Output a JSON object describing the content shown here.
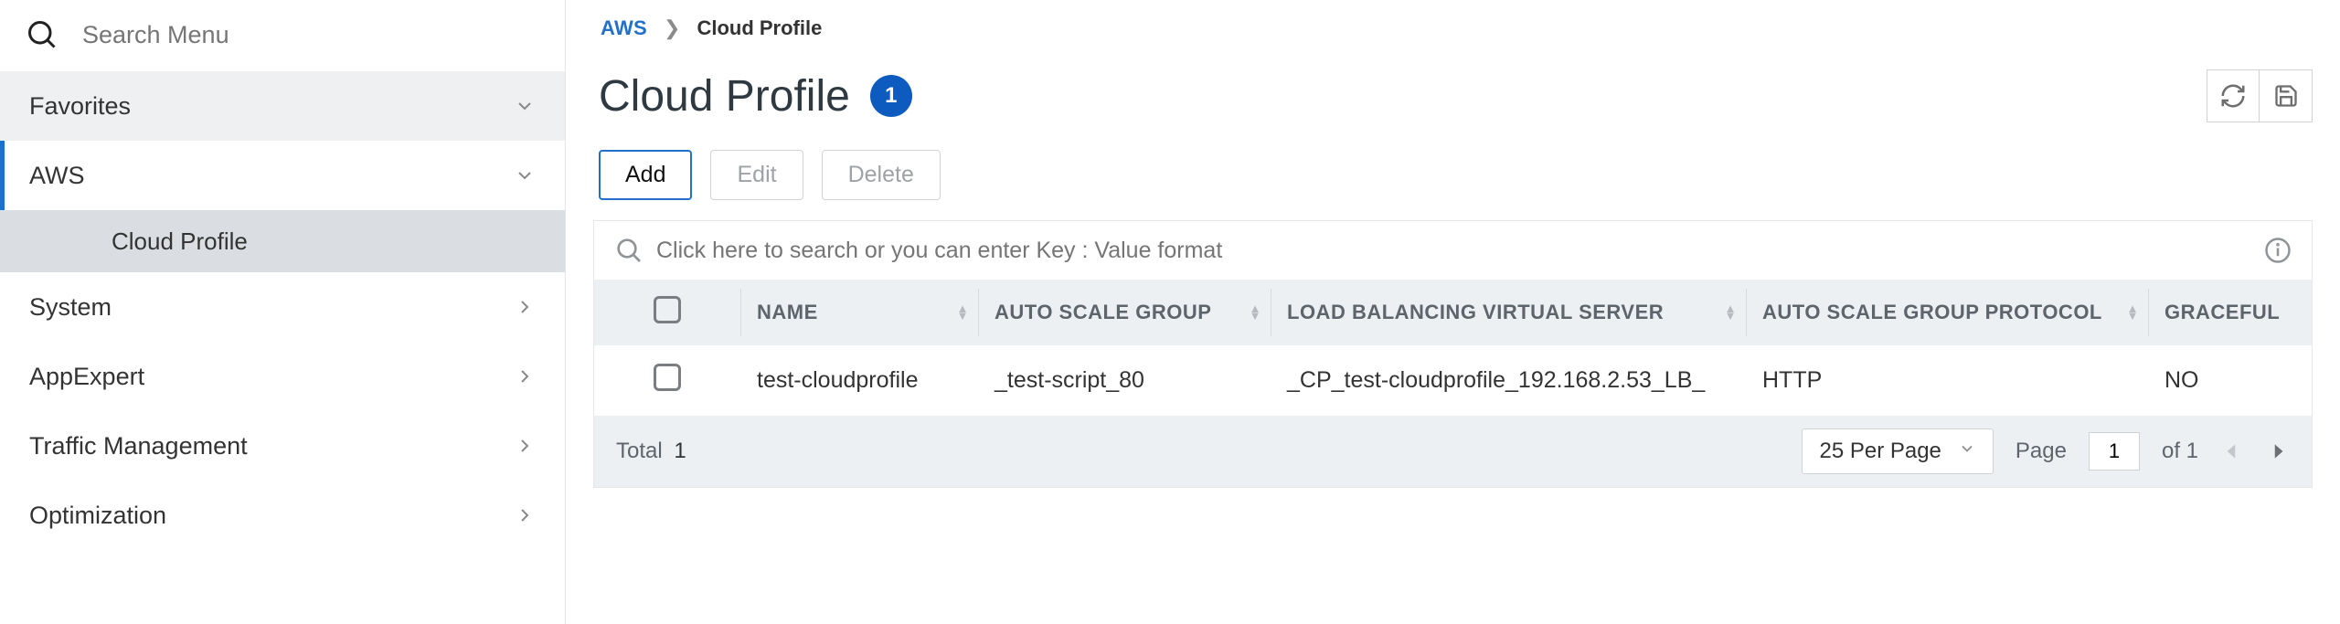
{
  "search": {
    "placeholder": "Search Menu"
  },
  "sidebar": {
    "favorites": "Favorites",
    "aws": "AWS",
    "aws_sub": "Cloud Profile",
    "items": [
      "System",
      "AppExpert",
      "Traffic Management",
      "Optimization"
    ]
  },
  "breadcrumb": {
    "root": "AWS",
    "current": "Cloud Profile"
  },
  "page": {
    "title": "Cloud Profile",
    "count": "1"
  },
  "buttons": {
    "add": "Add",
    "edit": "Edit",
    "delete": "Delete"
  },
  "filter": {
    "placeholder": "Click here to search or you can enter Key : Value format"
  },
  "table": {
    "headers": {
      "name": "NAME",
      "asg": "AUTO SCALE GROUP",
      "lbvs": "LOAD BALANCING VIRTUAL SERVER",
      "proto": "AUTO SCALE GROUP PROTOCOL",
      "graceful": "GRACEFUL"
    },
    "rows": [
      {
        "name": "test-cloudprofile",
        "asg": "_test-script_80",
        "lbvs": "_CP_test-cloudprofile_192.168.2.53_LB_",
        "proto": "HTTP",
        "graceful": "NO"
      }
    ]
  },
  "footer": {
    "total_label": "Total",
    "total_value": "1",
    "perpage": "25 Per Page",
    "page_label": "Page",
    "page_value": "1",
    "of_label": "of 1"
  }
}
